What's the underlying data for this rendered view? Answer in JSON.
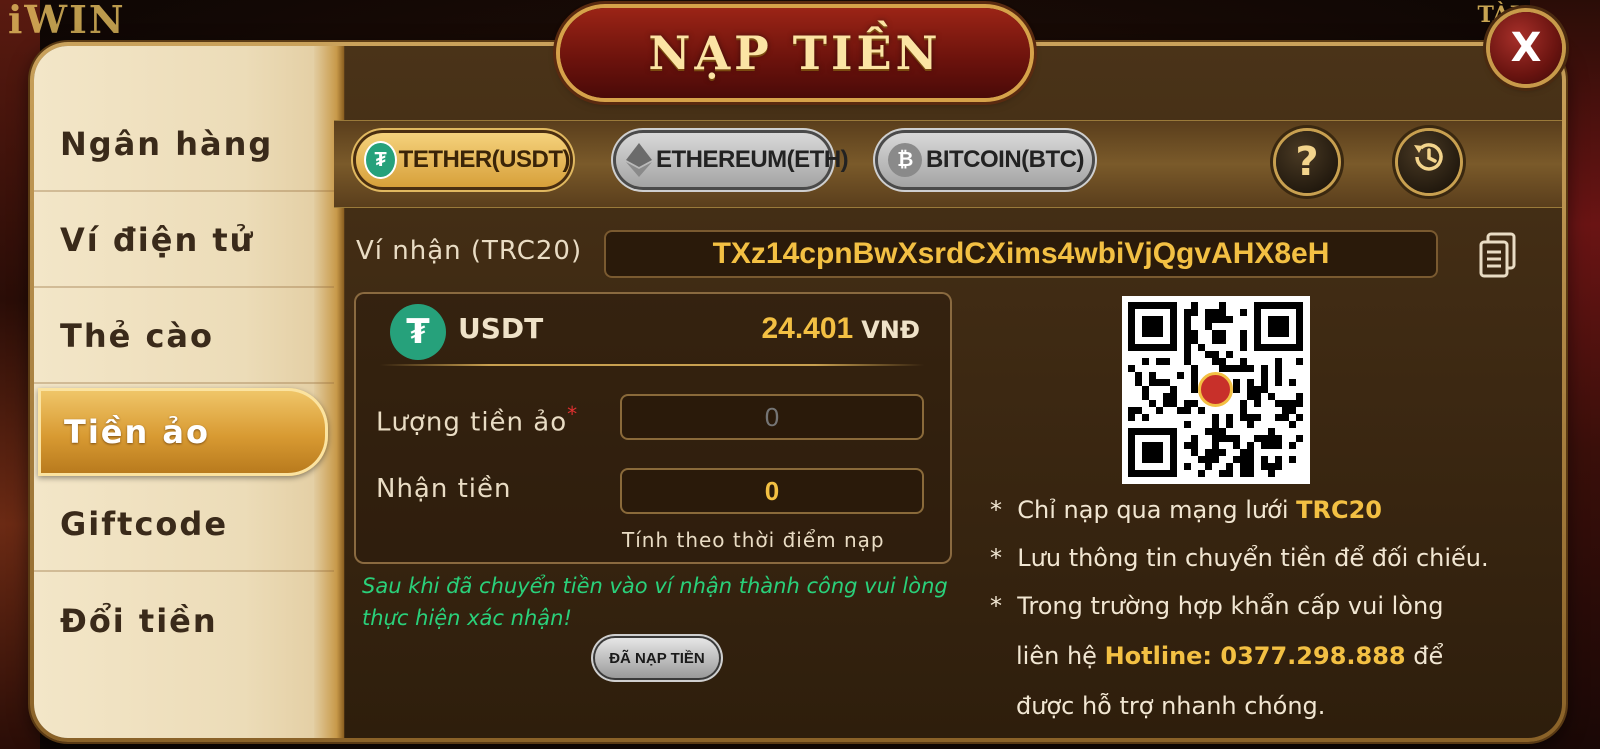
{
  "background": {
    "logo_text": "iWIN",
    "corner_text": "TÀI"
  },
  "header": {
    "title": "NẠP TIỀN",
    "close_label": "X"
  },
  "sidebar": {
    "items": [
      {
        "label": "Ngân hàng",
        "active": false
      },
      {
        "label": "Ví điện tử",
        "active": false
      },
      {
        "label": "Thẻ cào",
        "active": false
      },
      {
        "label": "Tiền ảo",
        "active": true
      },
      {
        "label": "Giftcode",
        "active": false
      },
      {
        "label": "Đổi tiền",
        "active": false
      }
    ]
  },
  "coin_tabs": [
    {
      "label": "TETHER(USDT)",
      "icon": "tether-icon",
      "active": true
    },
    {
      "label": "ETHEREUM(ETH)",
      "icon": "ethereum-icon",
      "active": false
    },
    {
      "label": "BITCOIN(BTC)",
      "icon": "bitcoin-icon",
      "active": false
    }
  ],
  "toolbar": {
    "help_label": "?",
    "history_icon": "history-icon"
  },
  "wallet": {
    "label": "Ví nhận (TRC20)",
    "address": "TXz14cpnBwXsrdCXims4wbiVjQgvAHX8eH",
    "copy_icon": "copy-icon"
  },
  "rate": {
    "coin": "USDT",
    "value": "24.401",
    "unit": "VNĐ"
  },
  "form": {
    "amount_label": "Lượng tiền ảo",
    "required_mark": "*",
    "amount_placeholder": "0",
    "receive_label": "Nhận tiền",
    "receive_value": "0",
    "rate_note": "Tính theo thời điểm nạp"
  },
  "note_text": "Sau khi đã chuyển tiền vào ví nhận thành công vui lòng thực hiện xác nhận!",
  "confirm_button": "ĐÃ NẠP TIỀN",
  "info": {
    "line1_prefix": "Chỉ nạp qua mạng lưới",
    "line1_highlight": "TRC20",
    "line2": "Lưu thông tin chuyển tiền để đối chiếu.",
    "line3": "Trong trường hợp khẩn cấp  vui lòng",
    "line4_prefix": "liên hệ",
    "line4_highlight": "Hotline: 0377.298.888",
    "line4_suffix": "để",
    "line5": "được hỗ trợ nhanh chóng.",
    "bullet": "*"
  },
  "colors": {
    "accent_gold": "#f3c043",
    "note_green": "#2ad07a",
    "tether_green": "#26a17b",
    "title_red": "#9b2416"
  }
}
